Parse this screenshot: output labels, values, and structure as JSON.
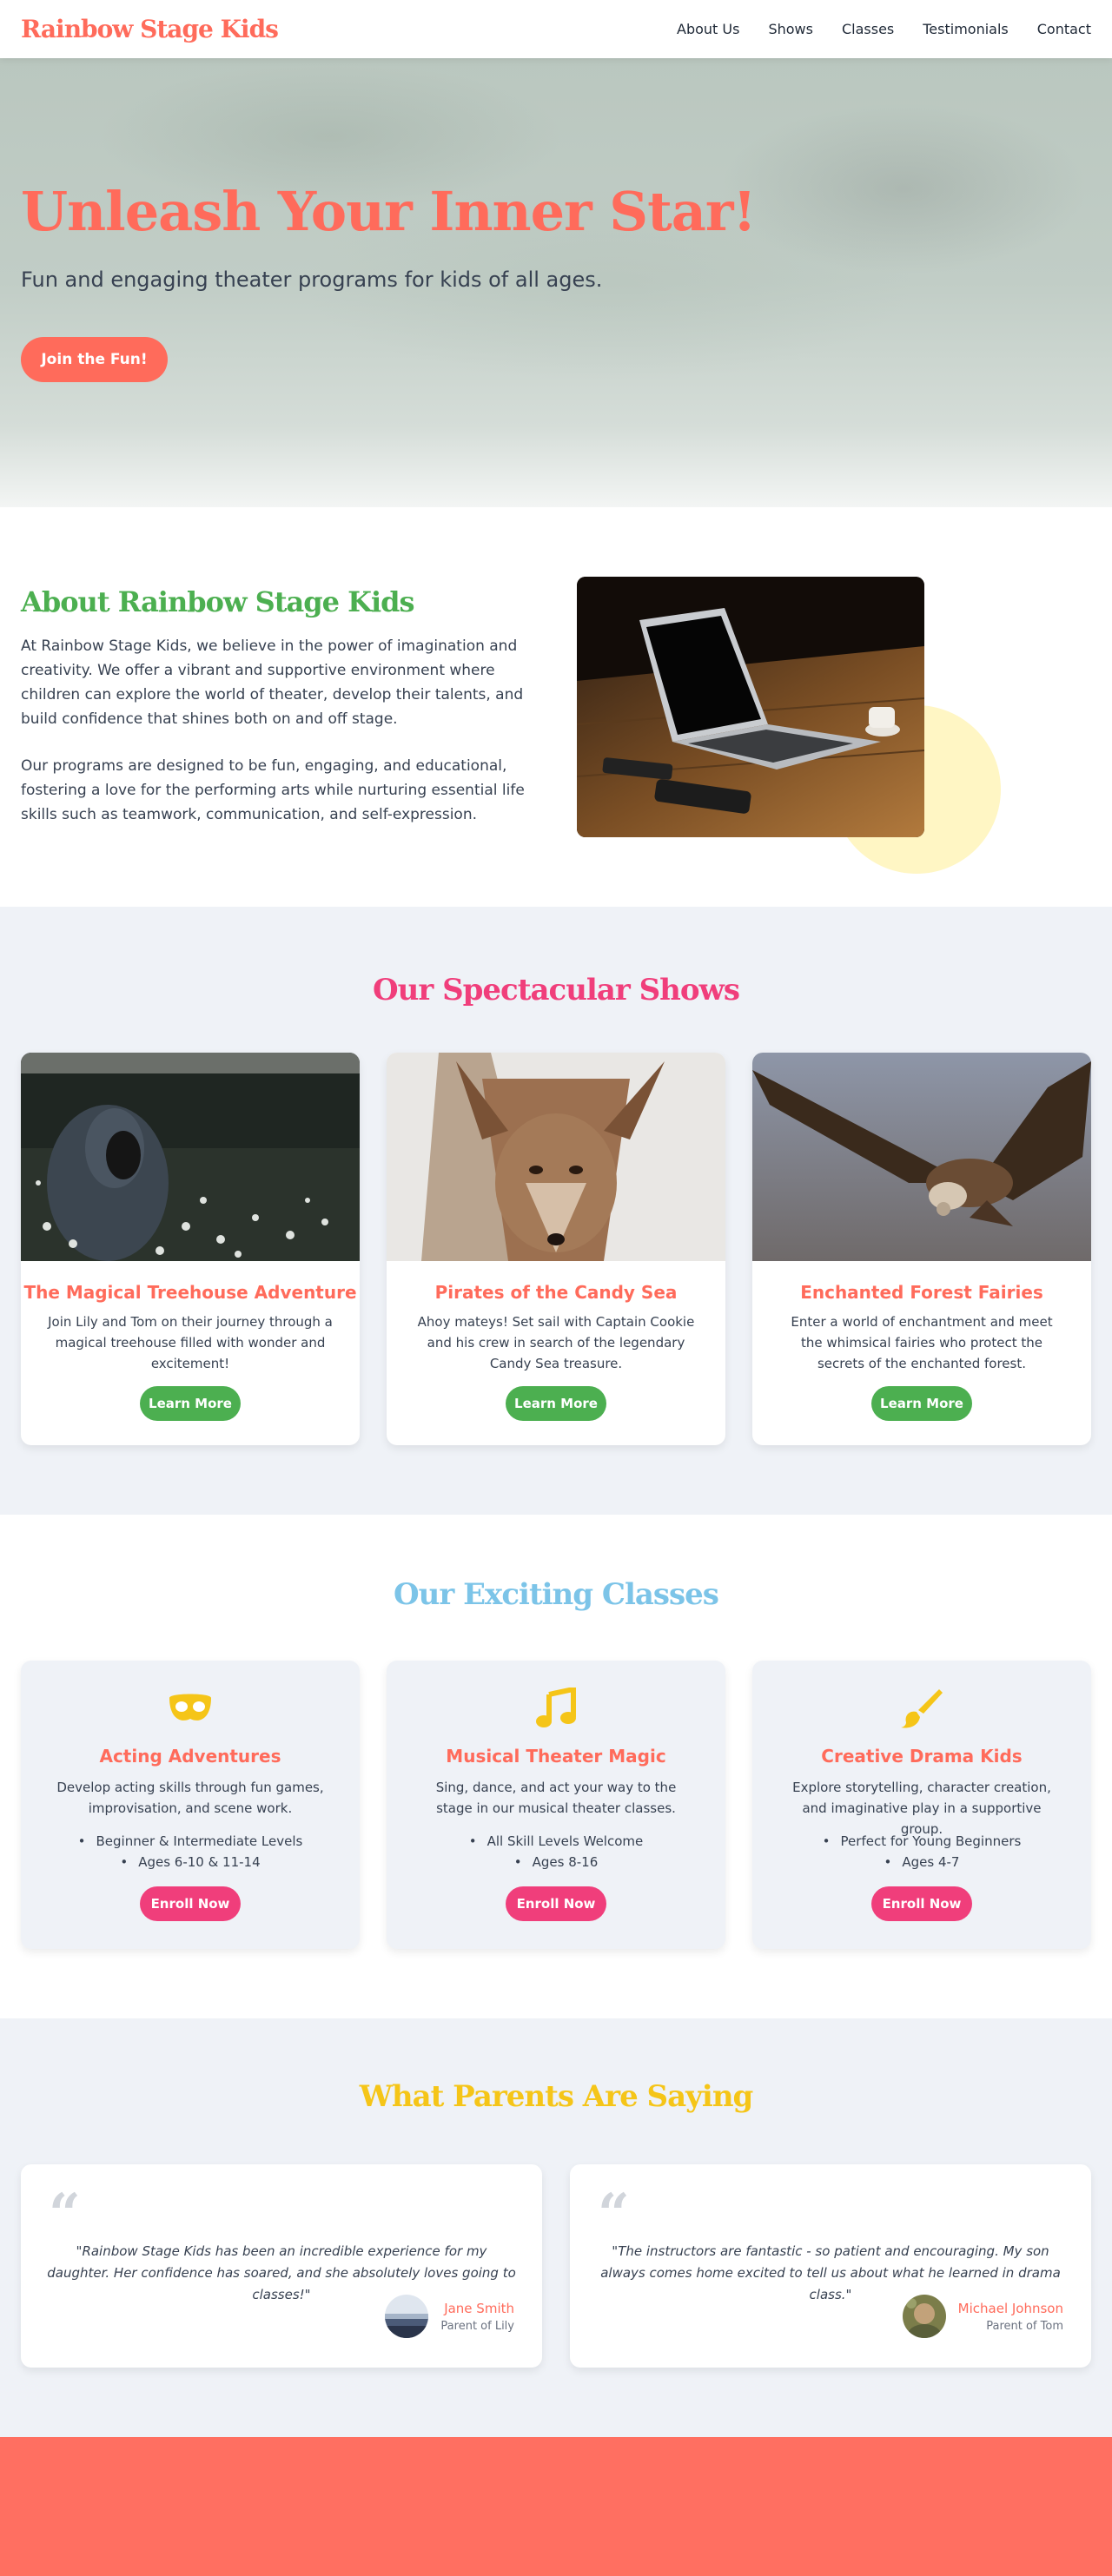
{
  "brand": "Rainbow Stage Kids",
  "nav": [
    "About Us",
    "Shows",
    "Classes",
    "Testimonials",
    "Contact"
  ],
  "hero": {
    "title": "Unleash Your Inner Star!",
    "subtitle": "Fun and engaging theater programs for kids of all ages.",
    "cta": "Join the Fun!"
  },
  "about": {
    "title": "About Rainbow Stage Kids",
    "p1": "At Rainbow Stage Kids, we believe in the power of imagination and creativity. We offer a vibrant and supportive environment where children can explore the world of theater, develop their talents, and build confidence that shines both on and off stage.",
    "p2": "Our programs are designed to be fun, engaging, and educational, fostering a love for the performing arts while nurturing essential life skills such as teamwork, communication, and self-expression."
  },
  "shows": {
    "title": "Our Spectacular Shows",
    "items": [
      {
        "title": "The Magical Treehouse Adventure",
        "desc": "Join Lily and Tom on their journey through a magical treehouse filled with wonder and excitement!",
        "button": "Learn More"
      },
      {
        "title": "Pirates of the Candy Sea",
        "desc": "Ahoy mateys! Set sail with Captain Cookie and his crew in search of the legendary Candy Sea treasure.",
        "button": "Learn More"
      },
      {
        "title": "Enchanted Forest Fairies",
        "desc": "Enter a world of enchantment and meet the whimsical fairies who protect the secrets of the enchanted forest.",
        "button": "Learn More"
      }
    ]
  },
  "classes": {
    "title": "Our Exciting Classes",
    "items": [
      {
        "icon": "mask-icon",
        "title": "Acting Adventures",
        "desc": "Develop acting skills through fun games, improvisation, and scene work.",
        "bullets": [
          "Beginner & Intermediate Levels",
          "Ages 6-10 & 11-14"
        ],
        "button": "Enroll Now"
      },
      {
        "icon": "music-note-icon",
        "title": "Musical Theater Magic",
        "desc": "Sing, dance, and act your way to the stage in our musical theater classes.",
        "bullets": [
          "All Skill Levels Welcome",
          "Ages 8-16"
        ],
        "button": "Enroll Now"
      },
      {
        "icon": "paintbrush-icon",
        "title": "Creative Drama Kids",
        "desc": "Explore storytelling, character creation, and imaginative play in a supportive group.",
        "bullets": [
          "Perfect for Young Beginners",
          "Ages 4-7"
        ],
        "button": "Enroll Now"
      }
    ]
  },
  "testimonials": {
    "title": "What Parents Are Saying",
    "items": [
      {
        "quote": "\"Rainbow Stage Kids has been an incredible experience for my daughter. Her confidence has soared, and she absolutely loves going to classes!\"",
        "name": "Jane Smith",
        "role": "Parent of Lily"
      },
      {
        "quote": "\"The instructors are fantastic - so patient and encouraging. My son always comes home excited to tell us about what he learned in drama class.\"",
        "name": "Michael Johnson",
        "role": "Parent of Tom"
      }
    ]
  },
  "colors": {
    "coral": "#ff6b5b",
    "green": "#4caf50",
    "pink": "#f03e7b",
    "sky": "#7cc4e8",
    "yellow": "#f5c518"
  }
}
